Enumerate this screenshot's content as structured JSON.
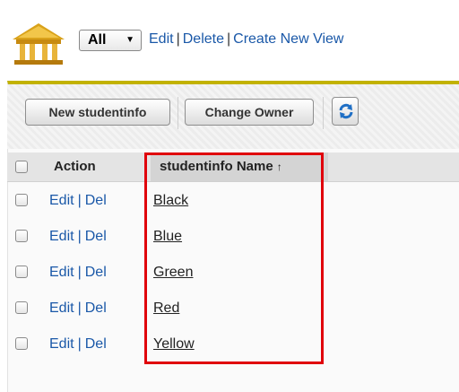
{
  "view_bar": {
    "select_value": "All",
    "links": [
      "Edit",
      "Delete",
      "Create New View"
    ],
    "separator": "|"
  },
  "buttons": {
    "new": "New studentinfo",
    "change_owner": "Change Owner"
  },
  "table": {
    "columns": [
      "Action",
      "studentinfo Name"
    ],
    "sort_indicator": "↑",
    "action_links": [
      "Edit",
      "Del"
    ],
    "action_separator": "|",
    "rows": [
      "Black",
      "Blue",
      "Green",
      "Red",
      "Yellow"
    ]
  },
  "colors": {
    "link": "#1a58a8",
    "highlight": "#e0000b",
    "accent_bar": "#c2b200"
  },
  "icons": [
    "building-icon",
    "chevron-down-icon",
    "refresh-icon",
    "sort-ascending-icon"
  ]
}
